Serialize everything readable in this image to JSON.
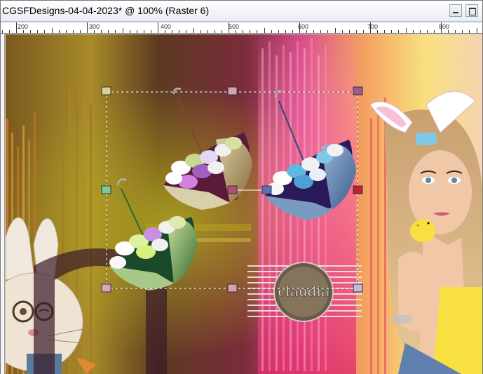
{
  "window": {
    "title": "CGSFDesigns-04-04-2023* @ 100% (Raster 6)"
  },
  "ruler": {
    "labels": [
      "200",
      "300",
      "400",
      "500",
      "600",
      "700",
      "800"
    ]
  },
  "watermark": {
    "text": "claudia"
  },
  "icons": {
    "minimize": "minimize-icon",
    "maximize": "maximize-icon"
  },
  "colors": {
    "selection_handle": "#d8a0b0",
    "marquee": "#ffffff"
  }
}
